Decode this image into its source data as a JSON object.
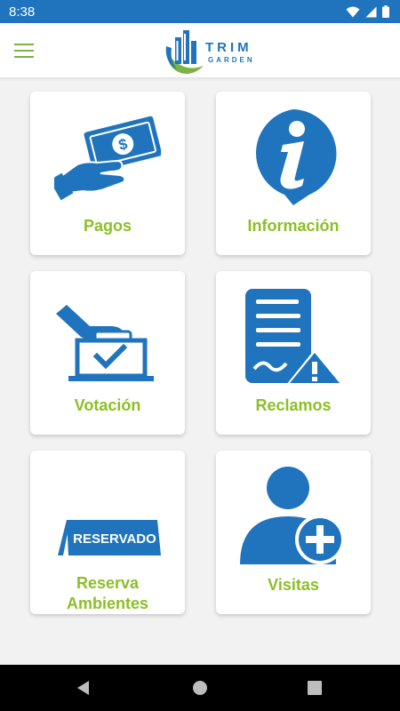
{
  "status_bar": {
    "time": "8:38",
    "icons": [
      "wifi-icon",
      "signal-icon",
      "battery-icon"
    ]
  },
  "header": {
    "menu_icon": "hamburger-menu-icon",
    "logo": {
      "word1": "TRIM",
      "word2": "GARDEN"
    }
  },
  "menu": {
    "items": [
      {
        "label": "Pagos",
        "icon": "payment-hand-bill-icon"
      },
      {
        "label": "Información",
        "icon": "info-pin-icon"
      },
      {
        "label": "Votación",
        "icon": "ballot-box-icon"
      },
      {
        "label": "Reclamos",
        "icon": "complaint-document-warning-icon"
      },
      {
        "label_line1": "Reserva",
        "label_line2": "Ambientes",
        "icon": "reserved-sign-icon",
        "sign_text": "RESERVADO"
      },
      {
        "label": "Visitas",
        "icon": "add-visitor-icon"
      }
    ]
  },
  "nav": {
    "icons": [
      "back-icon",
      "home-icon",
      "recents-icon"
    ]
  },
  "colors": {
    "primary_blue": "#1f74bd",
    "accent_green": "#8cbf26",
    "status_bar": "#1f74bd",
    "nav_bar": "#000000"
  }
}
